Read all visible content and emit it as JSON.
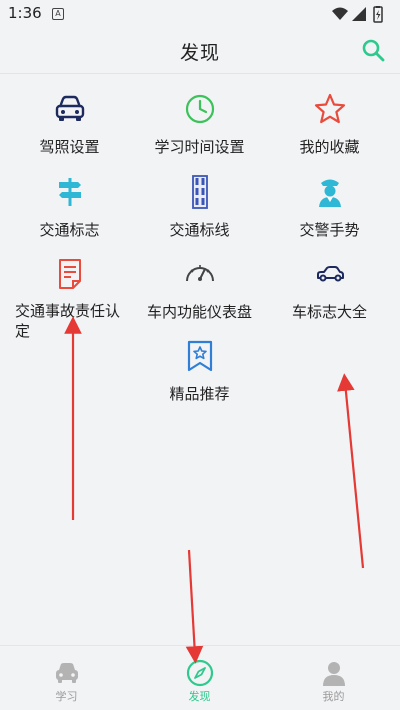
{
  "status": {
    "time": "1:36",
    "notif_glyph": "A"
  },
  "header": {
    "title": "发现",
    "search_icon": "search-icon"
  },
  "grid": [
    {
      "label": "驾照设置",
      "icon": "car-icon",
      "color": "#1d2a5e"
    },
    {
      "label": "学习时间设置",
      "icon": "clock-icon",
      "color": "#3cc25a"
    },
    {
      "label": "我的收藏",
      "icon": "star-icon",
      "color": "#e94b3c"
    },
    {
      "label": "交通标志",
      "icon": "signpost-icon",
      "color": "#2fb7d6"
    },
    {
      "label": "交通标线",
      "icon": "road-lines-icon",
      "color": "#3b56b8"
    },
    {
      "label": "交警手势",
      "icon": "police-icon",
      "color": "#2fb7d6"
    },
    {
      "label": "交通事故责任认定",
      "icon": "document-icon",
      "color": "#e94b3c"
    },
    {
      "label": "车内功能仪表盘",
      "icon": "gauge-icon",
      "color": "#444444"
    },
    {
      "label": "车标志大全",
      "icon": "car-logo-icon",
      "color": "#1d2a5e"
    },
    {
      "label": "精品推荐",
      "icon": "bookmark-star-icon",
      "color": "#2f7fd6"
    }
  ],
  "tabs": [
    {
      "label": "学习",
      "icon": "car-tab-icon",
      "active": false
    },
    {
      "label": "发现",
      "icon": "compass-icon",
      "active": true
    },
    {
      "label": "我的",
      "icon": "user-icon",
      "active": false
    }
  ],
  "colors": {
    "accent": "#2ec98c",
    "annotation": "#e53935"
  }
}
